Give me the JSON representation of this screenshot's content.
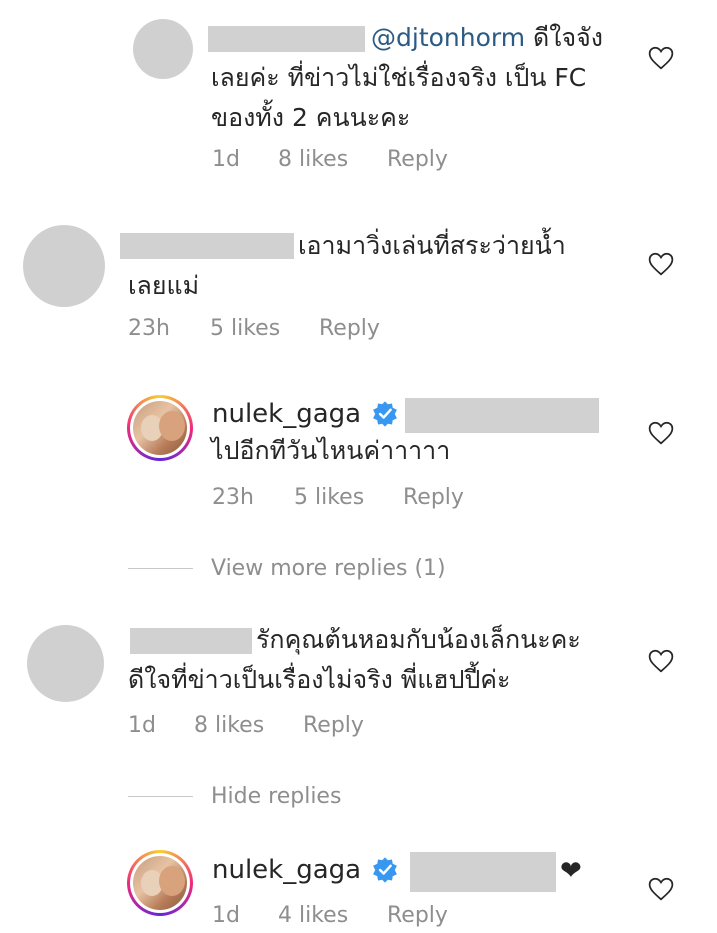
{
  "comments": [
    {
      "mention": "@djtonhorm",
      "text_line1": "ดีใจจัง",
      "text_line2": "เลยค่ะ ที่ข่าวไม่ใช่เรื่องจริง เป็น FC",
      "text_line3": "ของทั้ง 2 คนนะคะ",
      "time": "1d",
      "likes": "8 likes",
      "reply": "Reply"
    },
    {
      "text_line1": "เอามาวิ่งเล่นที่สระว่ายน้ำ",
      "text_line2": "เลยแม่",
      "time": "23h",
      "likes": "5 likes",
      "reply": "Reply"
    },
    {
      "username": "nulek_gaga",
      "text_line1": "ไปอีกทีวันไหนค่าาาาา",
      "time": "23h",
      "likes": "5 likes",
      "reply": "Reply"
    },
    {
      "text_line1": "รักคุณต้นหอมกับน้องเล็กนะคะ",
      "text_line2": "ดีใจที่ข่าวเป็นเรื่องไม่จริง พี่แฮปปี้ค่ะ",
      "time": "1d",
      "likes": "8 likes",
      "reply": "Reply"
    },
    {
      "username": "nulek_gaga",
      "text_line1": "❤",
      "time": "1d",
      "likes": "4 likes",
      "reply": "Reply"
    }
  ],
  "view_more_replies": "View more replies (1)",
  "hide_replies": "Hide replies",
  "icons": {
    "like": "heart-outline-icon",
    "verified": "verified-badge-icon"
  },
  "colors": {
    "mention": "#2b5b84",
    "meta": "#8e8e8e",
    "verified": "#3897f0"
  }
}
